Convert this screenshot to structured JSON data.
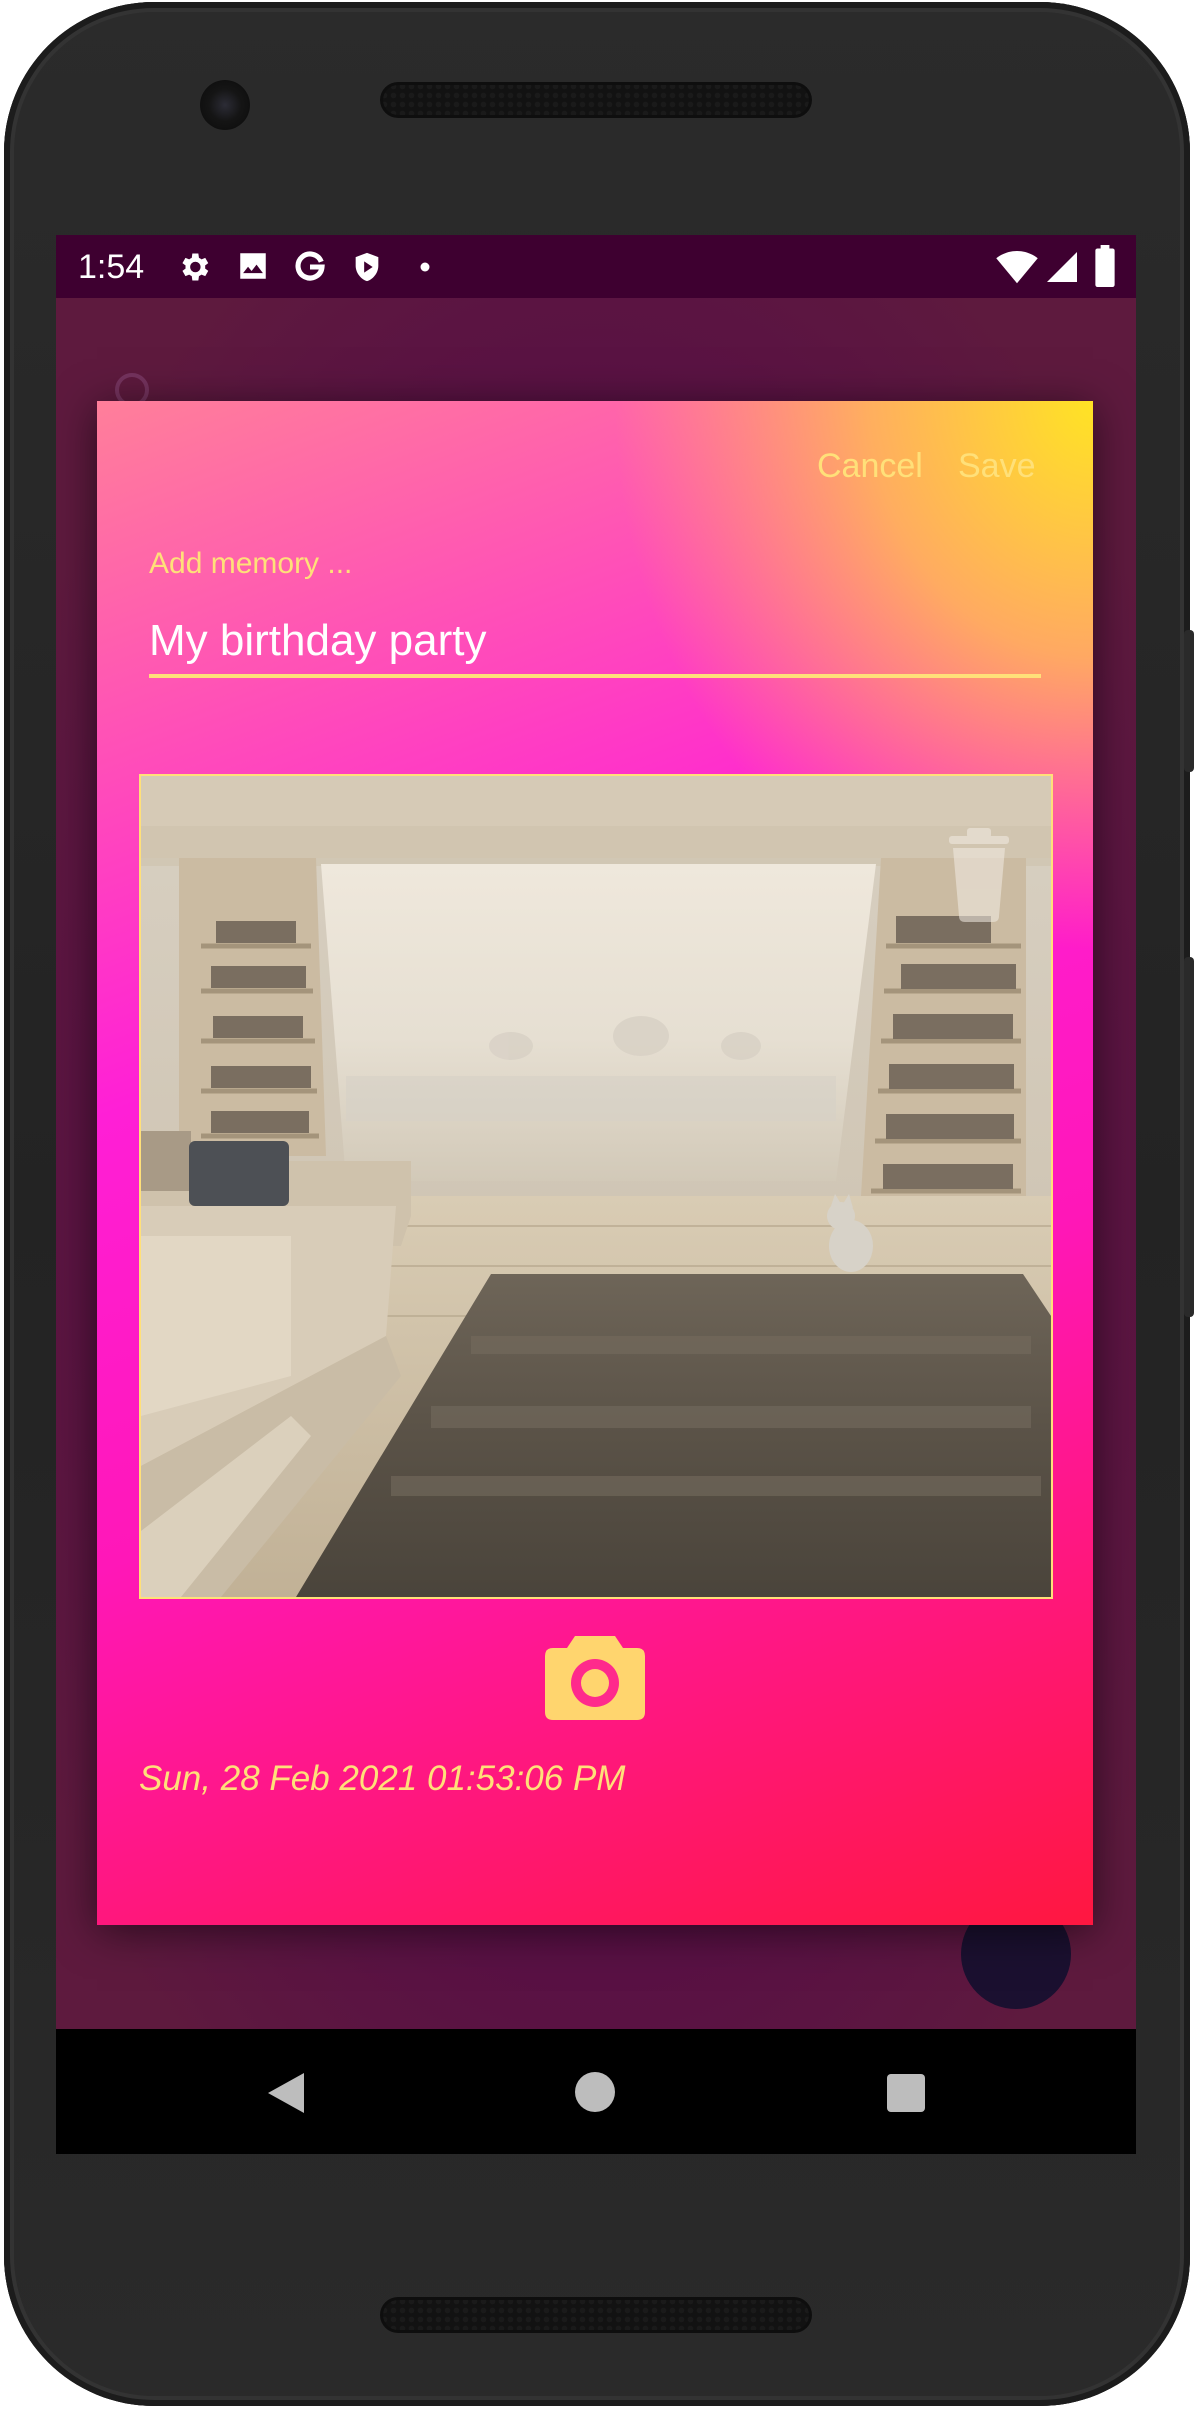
{
  "status_bar": {
    "time": "1:54",
    "left_icons": [
      "gear-icon",
      "image-icon",
      "google-g-icon",
      "shield-play-icon",
      "dot-icon"
    ],
    "right_icons": [
      "wifi-icon",
      "signal-icon",
      "battery-icon"
    ]
  },
  "dialog": {
    "cancel_label": "Cancel",
    "save_label": "Save",
    "memory_label": "Add memory ...",
    "memory_value": "My birthday party",
    "photo_alt": "Living room photo",
    "date": "Sun, 28 Feb 2021 01:53:06 PM",
    "accent_color": "#ffe079"
  },
  "nav_bar": {
    "buttons": [
      "back-icon",
      "home-icon",
      "recents-icon"
    ]
  }
}
